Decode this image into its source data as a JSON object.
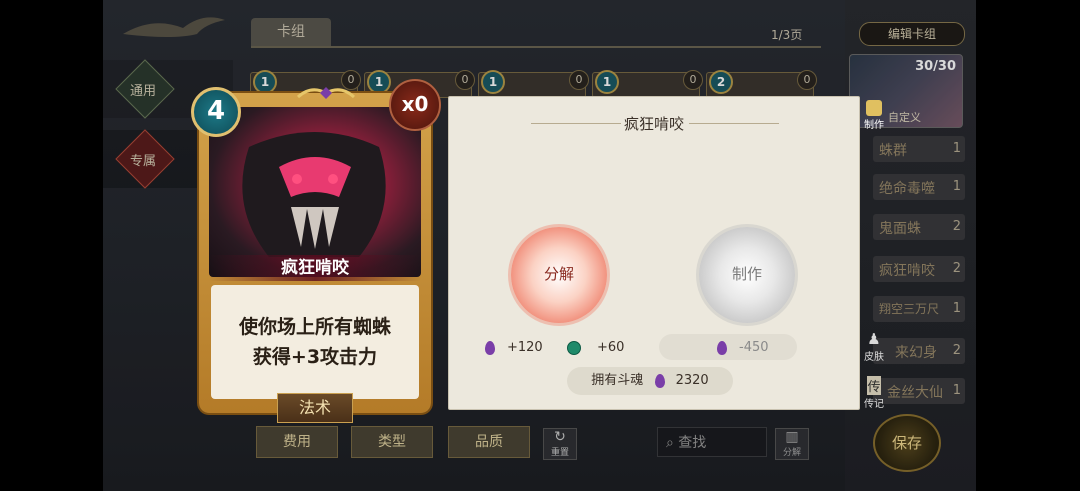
{
  "header": {
    "deck_tab": "卡组",
    "page_indicator": "1/3页"
  },
  "nav": {
    "general_label": "通用",
    "special_label": "专属"
  },
  "bg_cards": [
    {
      "cost": "1",
      "count": "0"
    },
    {
      "cost": "1",
      "count": "0"
    },
    {
      "cost": "1",
      "count": "0"
    },
    {
      "cost": "1",
      "count": "0"
    },
    {
      "cost": "2",
      "count": "0"
    }
  ],
  "right_panel": {
    "edit_deck": "编辑卡组",
    "deck_count": "30/30",
    "avatar_label": "自定义",
    "deck_list": [
      {
        "name": "蛛群",
        "qty": "1"
      },
      {
        "name": "绝命毒噬",
        "qty": "1"
      },
      {
        "name": "鬼面蛛",
        "qty": "2"
      },
      {
        "name": "疯狂啃咬",
        "qty": "2"
      },
      {
        "name": "翔空三万尺",
        "qty": "1"
      },
      {
        "name": "来幻身",
        "qty": "2"
      },
      {
        "name": "金丝大仙",
        "qty": "1"
      }
    ],
    "skin_label": "皮肤",
    "bio_label": "传记",
    "save_label": "保存"
  },
  "filters": {
    "cost": "费用",
    "type": "类型",
    "quality": "品质",
    "reset": "重置",
    "search_placeholder": "查找",
    "decompose": "分解"
  },
  "card": {
    "cost": "4",
    "owned": "x0",
    "name": "疯狂啃咬",
    "text_line1": "使你场上所有蜘蛛",
    "text_line2": "获得+3攻击力",
    "type": "法术"
  },
  "detail": {
    "title": "疯狂啃咬",
    "craft_tab": "制作",
    "disenchant_label": "分解",
    "craft_label": "制作",
    "reward_soul": "+120",
    "reward_green": "+60",
    "craft_cost": "-450",
    "owned_soul_label": "拥有斗魂",
    "owned_soul_value": "2320"
  }
}
